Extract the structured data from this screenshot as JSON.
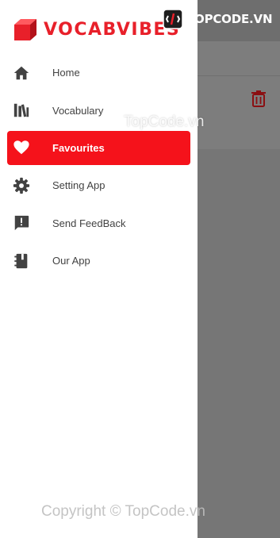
{
  "brand": {
    "name": "VOCABVIBES"
  },
  "menu": {
    "items": [
      {
        "label": "Home",
        "icon": "home-icon"
      },
      {
        "label": "Vocabulary",
        "icon": "library-icon"
      },
      {
        "label": "Favourites",
        "icon": "heart-icon",
        "active": true
      },
      {
        "label": "Setting App",
        "icon": "gear-icon"
      },
      {
        "label": "Send FeedBack",
        "icon": "feedback-icon"
      },
      {
        "label": "Our App",
        "icon": "app-icon"
      }
    ]
  },
  "watermark": {
    "logo_text": "TOPCODE.VN",
    "mid_text": "TopCode.vn",
    "bottom_text": "Copyright © TopCode.vn"
  },
  "colors": {
    "accent": "#f5121b",
    "brand": "#e8202a",
    "trash": "#8b0f12",
    "scrim": "#7a7a7a"
  }
}
